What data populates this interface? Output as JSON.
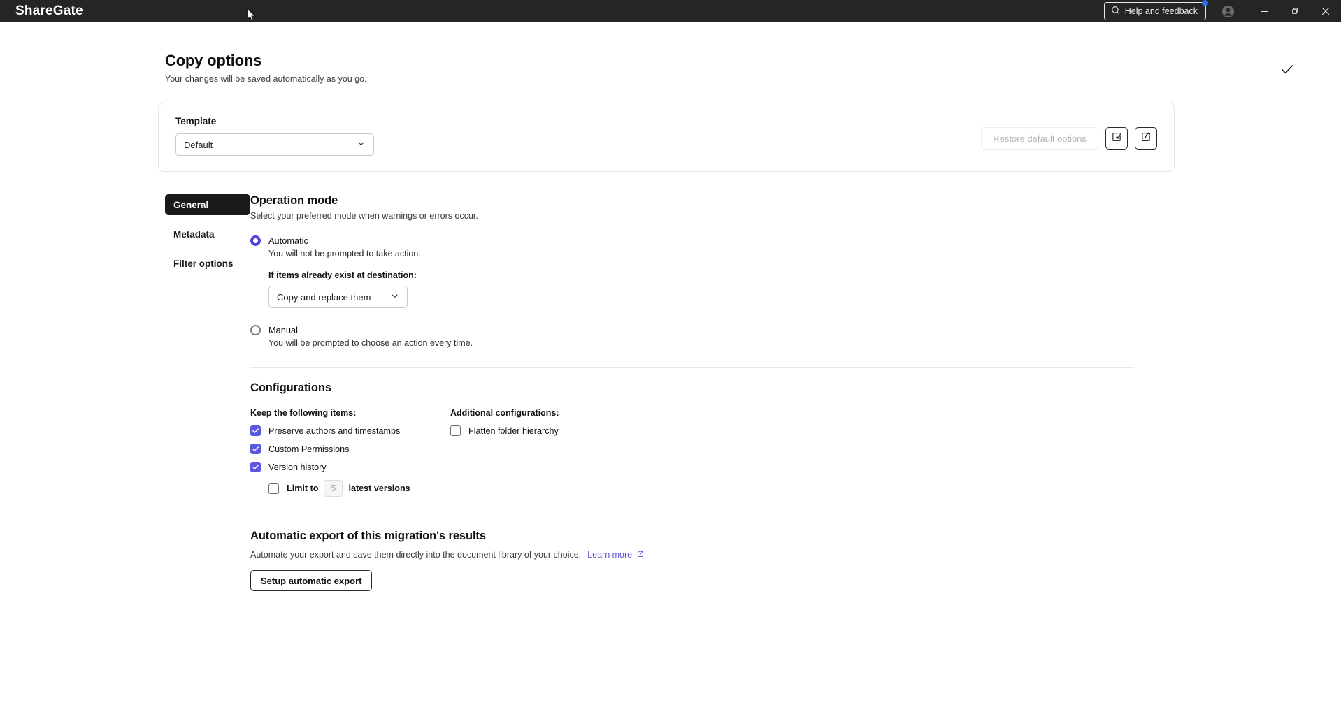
{
  "titlebar": {
    "brand": "ShareGate",
    "help_label": "Help and feedback",
    "help_icon": "search-chat-icon",
    "account_icon": "account-circle-icon",
    "minimize_icon": "minimize-icon",
    "restore_icon": "restore-window-icon",
    "close_icon": "close-icon"
  },
  "header": {
    "title": "Copy options",
    "subtitle": "Your changes will be saved automatically as you go.",
    "confirm_icon": "checkmark-icon"
  },
  "template_card": {
    "label": "Template",
    "selected": "Default",
    "chevron_icon": "chevron-down-icon",
    "restore_label": "Restore default options",
    "import_icon": "import-options-icon",
    "export_icon": "export-options-icon"
  },
  "sidebar": {
    "items": [
      {
        "label": "General",
        "active": true
      },
      {
        "label": "Metadata",
        "active": false
      },
      {
        "label": "Filter options",
        "active": false
      }
    ]
  },
  "operation_mode": {
    "title": "Operation mode",
    "subtitle": "Select your preferred mode when warnings or errors occur.",
    "automatic": {
      "label": "Automatic",
      "description": "You will not be prompted to take action.",
      "selected": true
    },
    "exists_label": "If items already exist at destination:",
    "exists_value": "Copy and replace them",
    "manual": {
      "label": "Manual",
      "description": "You will be prompted to choose an action every time.",
      "selected": false
    }
  },
  "configurations": {
    "title": "Configurations",
    "keep_label": "Keep the following items:",
    "keep_items": [
      {
        "label": "Preserve authors and timestamps",
        "checked": true
      },
      {
        "label": "Custom Permissions",
        "checked": true
      },
      {
        "label": "Version history",
        "checked": true
      }
    ],
    "limit": {
      "checked": false,
      "prefix": "Limit to",
      "value": "5",
      "suffix": "latest versions"
    },
    "additional_label": "Additional configurations:",
    "additional_items": [
      {
        "label": "Flatten folder hierarchy",
        "checked": false
      }
    ]
  },
  "auto_export": {
    "title": "Automatic export of this migration's results",
    "subtitle": "Automate your export and save them directly into the document library of your choice.",
    "learn_more": "Learn more",
    "external_link_icon": "external-link-icon",
    "setup_button": "Setup automatic export"
  },
  "colors": {
    "accent": "#5a57e0",
    "radio_accent": "#4f46d8",
    "titlebar_bg": "#252526",
    "link": "#5b52e0",
    "badge": "#2f6feb"
  }
}
